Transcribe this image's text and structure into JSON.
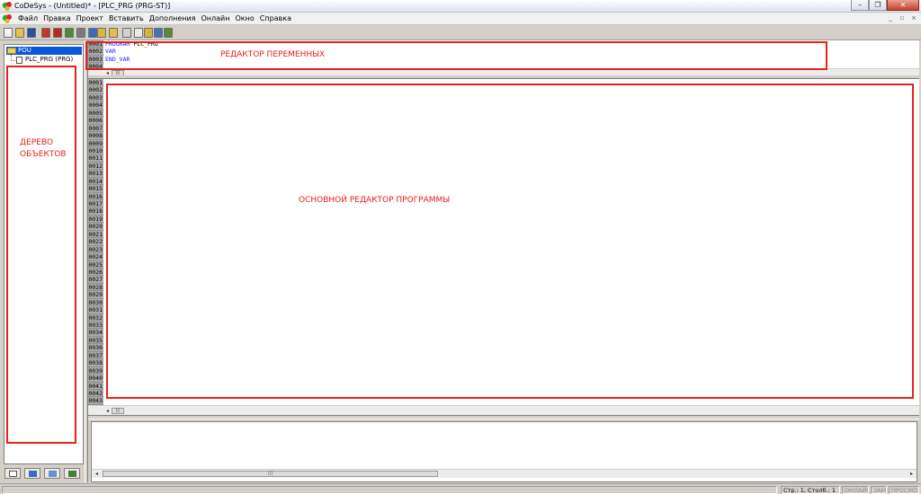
{
  "window": {
    "title": "CoDeSys - (Untitled)* - [PLC_PRG (PRG-ST)]",
    "controls": [
      "–",
      "❐",
      "✕"
    ]
  },
  "menubar": {
    "items": [
      "Файл",
      "Правка",
      "Проект",
      "Вставить",
      "Дополнения",
      "Онлайн",
      "Окно",
      "Справка"
    ],
    "mdi_controls": [
      "_",
      "▫",
      "×"
    ]
  },
  "object_tree": {
    "root_label": "POU",
    "child_label": "PLC_PRG (PRG)"
  },
  "declaration_editor": {
    "line_numbers": [
      "0001",
      "0002",
      "0003",
      "0004"
    ],
    "lines": [
      {
        "keyword": "PROGRAM",
        "rest": " PLC_PRG"
      },
      {
        "keyword": "VAR",
        "rest": ""
      },
      {
        "keyword": "END_VAR",
        "rest": ""
      }
    ]
  },
  "main_editor": {
    "line_numbers": [
      "0001",
      "0002",
      "0003",
      "0004",
      "0005",
      "0006",
      "0007",
      "0008",
      "0009",
      "0010",
      "0011",
      "0012",
      "0013",
      "0014",
      "0015",
      "0016",
      "0017",
      "0018",
      "0019",
      "0020",
      "0021",
      "0022",
      "0023",
      "0024",
      "0025",
      "0026",
      "0027",
      "0028",
      "0029",
      "0030",
      "0031",
      "0032",
      "0033",
      "0034",
      "0035",
      "0036",
      "0037",
      "0038",
      "0039",
      "0040",
      "0041",
      "0042",
      "0043"
    ]
  },
  "annotations": {
    "tree": "ДЕРЕВО ОБЪЕКТОВ",
    "declaration": "РЕДАКТОР ПЕРЕМЕННЫХ",
    "main": "ОСНОВНОЙ РЕДАКТОР ПРОГРАММЫ"
  },
  "scroll": {
    "left_arrow": "◂",
    "right_arrow": "▸",
    "thumb": "|||"
  },
  "statusbar": {
    "position": "Стр.: 1, Столб.: 1",
    "online": "ОНЛАЙН",
    "replace": "ЗАМ",
    "view": "ПРОСМОТР"
  },
  "colors": {
    "annotation": "#e8201a",
    "keyword": "#1a1aff",
    "selection": "#0a55d8"
  }
}
